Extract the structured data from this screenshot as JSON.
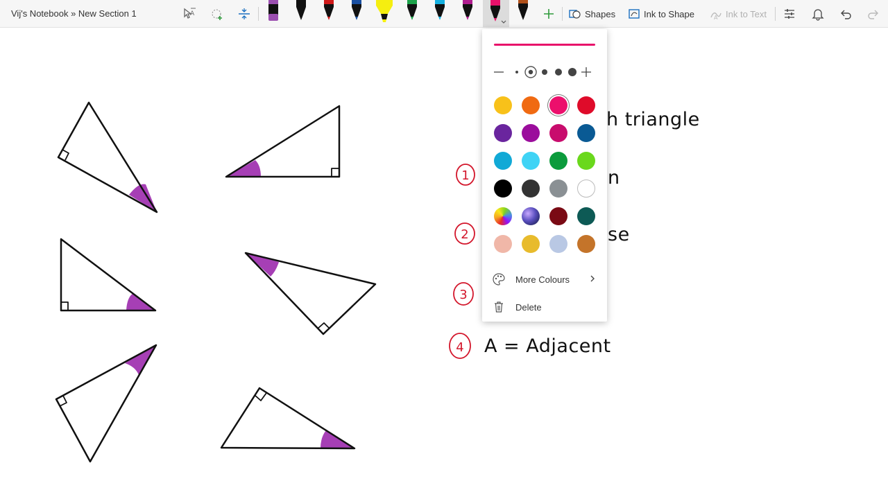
{
  "breadcrumb": "Vij's Notebook » New Section 1",
  "toolbar": {
    "shapes_label": "Shapes",
    "ink_to_shape_label": "Ink to Shape",
    "ink_to_text_label": "Ink to Text",
    "pens": [
      {
        "name": "pen-purple",
        "color": "#9b4fb0"
      },
      {
        "name": "pen-black",
        "color": "#111111"
      },
      {
        "name": "pen-red",
        "color": "#d01a1a"
      },
      {
        "name": "pen-blue",
        "color": "#1a4fa0"
      },
      {
        "name": "highlighter-yellow",
        "color": "#f5ee10"
      },
      {
        "name": "pen-green",
        "color": "#1ca24a"
      },
      {
        "name": "pen-cyan",
        "color": "#16b0e0"
      },
      {
        "name": "pen-magenta",
        "color": "#b01d8f"
      },
      {
        "name": "pen-pink-active",
        "color": "#e8116a"
      },
      {
        "name": "pen-brown",
        "color": "#b0501a"
      }
    ]
  },
  "popup": {
    "stroke_color": "#e8116a",
    "swatches": [
      [
        "#f8c11a",
        "#f06a12",
        "#ec0f6c",
        "#df0b2a"
      ],
      [
        "#6a259e",
        "#9b0d9c",
        "#c80c6d",
        "#0a5a94"
      ],
      [
        "#11a9d6",
        "#3fd3f5",
        "#0b9b3c",
        "#6ad81c"
      ],
      [
        "#000000",
        "#333333",
        "#8a9094",
        "#ffffff"
      ],
      [
        "rainbow",
        "galaxy",
        "#7a0a14",
        "#0d5a55"
      ],
      [
        "#f0b7a8",
        "#e8bb2c",
        "#b9c8e4",
        "#c4742a"
      ]
    ],
    "selected_swatch": "#ec0f6c",
    "more_colours_label": "More Colours",
    "delete_label": "Delete"
  },
  "notes": {
    "heading_fragment": "h triangle",
    "line1_fragment": "n",
    "line2_fragment": "se",
    "line4": "A = Adjacent",
    "numbers": [
      "1",
      "2",
      "3",
      "4"
    ]
  },
  "colors": {
    "angle_fill": "#a63fb5",
    "ink_number": "#d3162b",
    "ink": "#111111"
  }
}
